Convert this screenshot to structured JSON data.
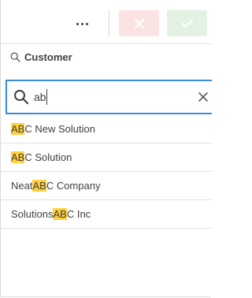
{
  "toolbar": {
    "more_icon": "more-horizontal-icon",
    "cancel_icon": "close-icon",
    "confirm_icon": "checkmark-icon",
    "cancel_bg": "#fbe3e3",
    "cancel_icon_color": "#ffffff",
    "confirm_bg": "#e3f1e3",
    "confirm_icon_color": "#ffffff"
  },
  "field": {
    "title": "Customer",
    "icon": "search-icon"
  },
  "search": {
    "value": "ab",
    "icon": "search-icon",
    "clear_icon": "close-icon",
    "border_color": "#3a8ad6"
  },
  "highlight_color": "#ffcf3e",
  "results": [
    {
      "before": "",
      "match": "AB",
      "after": "C New Solution"
    },
    {
      "before": "",
      "match": "AB",
      "after": "C Solution"
    },
    {
      "before": "Neat ",
      "match": "AB",
      "after": "C Company"
    },
    {
      "before": "Solutions ",
      "match": "AB",
      "after": "C Inc"
    }
  ]
}
